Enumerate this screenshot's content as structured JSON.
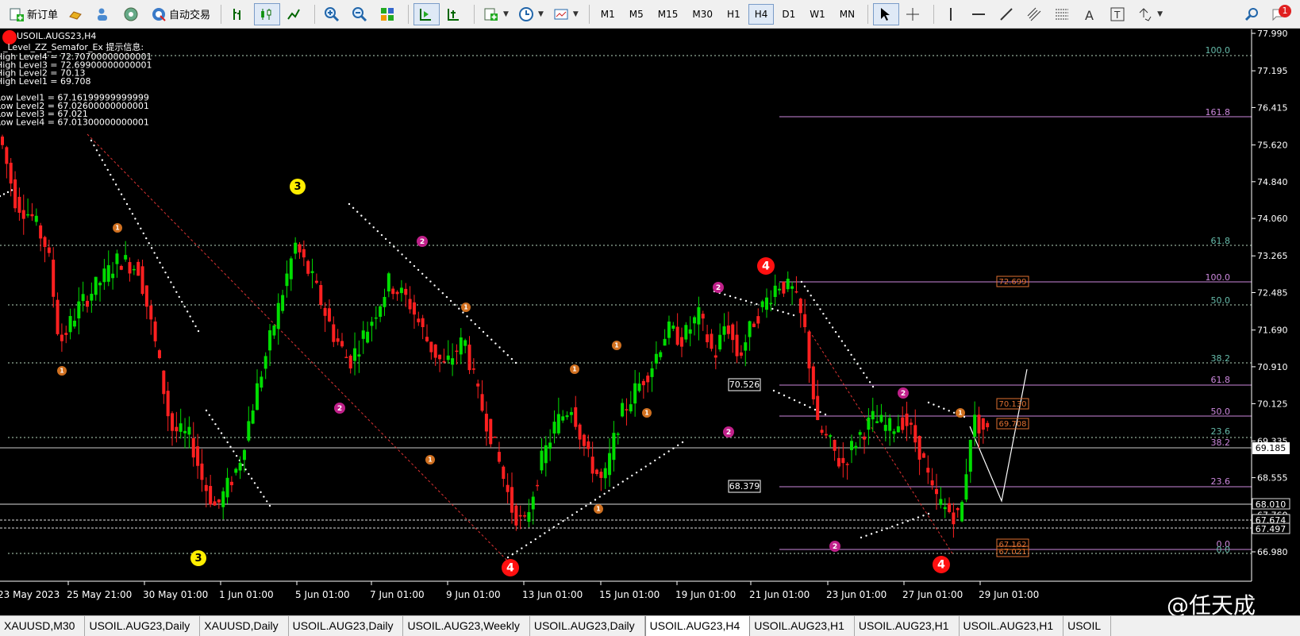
{
  "toolbar": {
    "new_order_label": "新订单",
    "auto_trading_label": "自动交易",
    "timeframes": [
      "M1",
      "M5",
      "M15",
      "M30",
      "H1",
      "H4",
      "D1",
      "W1",
      "MN"
    ],
    "active_timeframe": "H4",
    "notification_count": "1"
  },
  "chart": {
    "symbol_title": "USOIL.AUGS23,H4",
    "indicator_info": {
      "title": "_Level_ZZ_Semafor_Ex 提示信息:",
      "lines": [
        "High Level4 = 72.70700000000001",
        "High Level3 = 72.69900000000001",
        "High Level2 = 70.13",
        "High Level1 = 69.708",
        "",
        "Low Level1 = 67.16199999999999",
        "Low Level2 = 67.02600000000001",
        "Low Level3 = 67.021",
        "Low Level4 = 67.01300000000001"
      ]
    },
    "price_ticks": [
      "77.990",
      "77.195",
      "76.415",
      "75.620",
      "74.840",
      "74.060",
      "73.265",
      "72.485",
      "71.690",
      "70.910",
      "70.125",
      "69.335",
      "68.555",
      "67.760",
      "66.980"
    ],
    "price_min": 66.98,
    "price_max": 77.99,
    "current_price": "69.185",
    "level_boxes": [
      "68.010",
      "67.674",
      "67.497"
    ],
    "date_labels": [
      "23 May 2023",
      "25 May 21:00",
      "30 May 01:00",
      "1 Jun 01:00",
      "5 Jun 01:00",
      "7 Jun 01:00",
      "9 Jun 01:00",
      "13 Jun 01:00",
      "15 Jun 01:00",
      "19 Jun 01:00",
      "21 Jun 01:00",
      "23 Jun 01:00",
      "27 Jun 01:00",
      "29 Jun 01:00"
    ],
    "fib_left_labels": [
      "100.0",
      "161.8",
      "61.8",
      "50.0",
      "38.2",
      "23.6"
    ],
    "fib_right_labels": [
      "100.0",
      "50.0",
      "38.2",
      "61.8",
      "50.0",
      "23.6",
      "23.6",
      "0.0",
      "0.0"
    ],
    "price_boxes": [
      "70.526",
      "68.379"
    ],
    "orange_labels": [
      "72.699",
      "70.130",
      "69.708",
      "67.162",
      "67.021"
    ],
    "semafor_values": [
      "1",
      "2",
      "3",
      "4"
    ]
  },
  "tabs": [
    "XAUUSD,M30",
    "USOIL.AUG23,Daily",
    "XAUUSD,Daily",
    "USOIL.AUG23,Daily",
    "USOIL.AUG23,Weekly",
    "USOIL.AUG23,Daily",
    "USOIL.AUG23,H4",
    "USOIL.AUG23,H1",
    "USOIL.AUG23,H1",
    "USOIL.AUG23,H1",
    "USOIL"
  ],
  "active_tab": 6,
  "watermark": "@任天成",
  "colors": {
    "bull": "#00dd00",
    "bear": "#ff2020",
    "semafor1": "#d07020",
    "semafor2": "#c0208a",
    "semafor3": "#ffee00",
    "semafor4": "#ff1010",
    "fib_teal": "#66bbaa",
    "fib_violet": "#cc88dd"
  }
}
